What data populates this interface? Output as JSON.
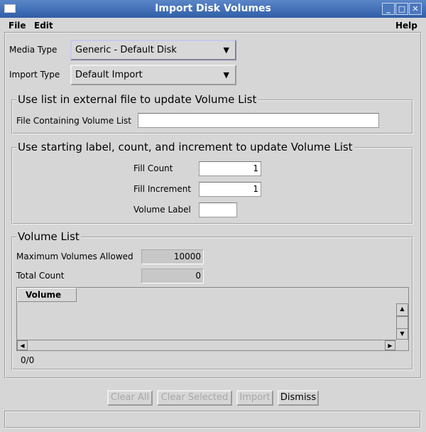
{
  "window": {
    "title": "Import Disk Volumes"
  },
  "menu": {
    "file": "File",
    "edit": "Edit",
    "help": "Help"
  },
  "media_type": {
    "label": "Media Type",
    "value": "Generic - Default Disk"
  },
  "import_type": {
    "label": "Import Type",
    "value": "Default Import"
  },
  "external_file": {
    "title": "Use list in external file to update Volume List",
    "label": "File Containing Volume List",
    "value": ""
  },
  "fill": {
    "title": "Use starting label, count, and increment to update Volume List",
    "count_label": "Fill Count",
    "count_value": "1",
    "increment_label": "Fill Increment",
    "increment_value": "1",
    "volume_label": "Volume Label",
    "volume_value": ""
  },
  "volume_list": {
    "title": "Volume List",
    "max_label": "Maximum Volumes Allowed",
    "max_value": "10000",
    "total_label": "Total Count",
    "total_value": "0",
    "column": "Volume",
    "counter": "0/0"
  },
  "buttons": {
    "clear_all": "Clear All",
    "clear_selected": "Clear Selected",
    "import": "Import",
    "dismiss": "Dismiss"
  },
  "status": ""
}
